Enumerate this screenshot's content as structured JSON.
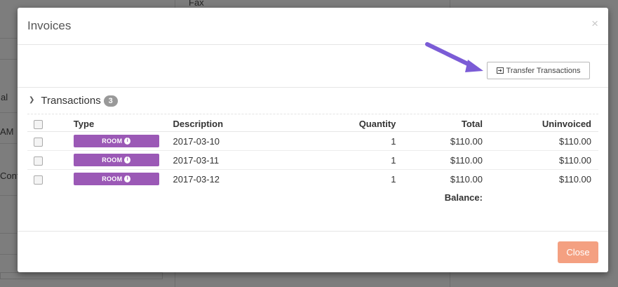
{
  "background": {
    "fragments": [
      "Fax",
      "al",
      "AM",
      "Conf"
    ]
  },
  "modal": {
    "title": "Invoices",
    "close_x": "×",
    "transfer_label": "Transfer Transactions",
    "section_title": "Transactions",
    "count": "3",
    "columns": {
      "type": "Type",
      "description": "Description",
      "quantity": "Quantity",
      "total": "Total",
      "uninvoiced": "Uninvoiced"
    },
    "rows": [
      {
        "type": "ROOM",
        "description": "2017-03-10",
        "quantity": "1",
        "total": "$110.00",
        "uninvoiced": "$110.00"
      },
      {
        "type": "ROOM",
        "description": "2017-03-11",
        "quantity": "1",
        "total": "$110.00",
        "uninvoiced": "$110.00"
      },
      {
        "type": "ROOM",
        "description": "2017-03-12",
        "quantity": "1",
        "total": "$110.00",
        "uninvoiced": "$110.00"
      }
    ],
    "balance_label": "Balance:",
    "close_label": "Close"
  },
  "colors": {
    "accent_room": "#9b59b6",
    "close_button": "#f4a081",
    "arrow": "#7b5cd6"
  }
}
